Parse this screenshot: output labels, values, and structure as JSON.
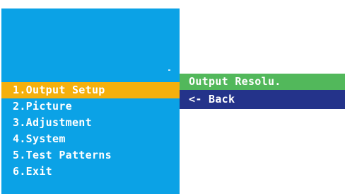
{
  "main_menu": {
    "items": [
      {
        "label": "1.Output Setup",
        "active": true
      },
      {
        "label": "2.Picture",
        "active": false
      },
      {
        "label": "3.Adjustment",
        "active": false
      },
      {
        "label": "4.System",
        "active": false
      },
      {
        "label": "5.Test Patterns",
        "active": false
      },
      {
        "label": "6.Exit",
        "active": false
      }
    ]
  },
  "submenu": {
    "items": [
      {
        "label": "Output Resolu.",
        "selected": true
      },
      {
        "label": "<- Back",
        "selected": false
      }
    ]
  },
  "colors": {
    "menu_bg": "#0ba2e6",
    "active_item": "#f5b00d",
    "sub_selected": "#52b85b",
    "sub_back": "#24338a"
  }
}
